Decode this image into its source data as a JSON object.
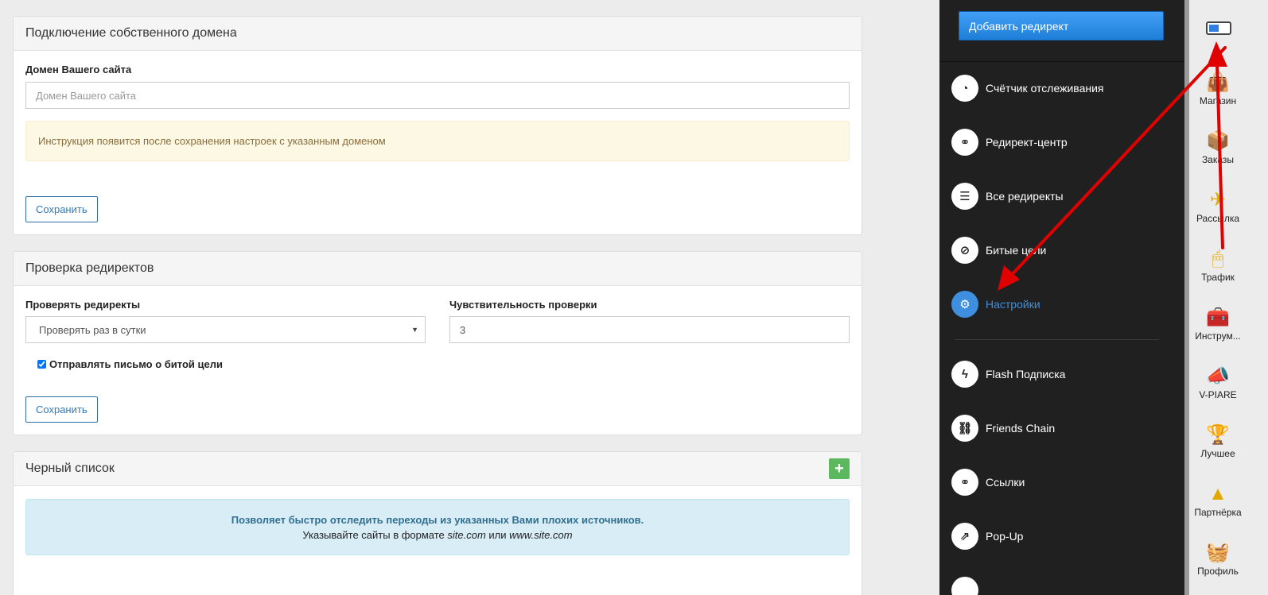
{
  "domain_panel": {
    "title": "Подключение собственного домена",
    "field_label": "Домен Вашего сайта",
    "field_placeholder": "Домен Вашего сайта",
    "notice": "Инструкция появится после сохранения настроек с указанным доменом",
    "save_label": "Сохранить"
  },
  "redirect_check_panel": {
    "title": "Проверка редиректов",
    "check_label": "Проверять редиректы",
    "check_value": "Проверять раз в сутки",
    "sensitivity_label": "Чувствительность проверки",
    "sensitivity_value": "3",
    "email_checkbox_label": "Отправлять письмо о битой цели",
    "email_checked": true,
    "save_label": "Сохранить"
  },
  "blacklist_panel": {
    "title": "Черный список",
    "add_label": "+",
    "info_line1": "Позволяет быстро отследить переходы из указанных Вами плохих источников.",
    "info_line2_prefix": "Указывайте сайты в формате ",
    "info_example1": "site.com",
    "info_or": " или ",
    "info_example2": "www.site.com"
  },
  "sidebar": {
    "add_button": "Добавить редирект",
    "items": [
      {
        "label": "Счётчик отслеживания",
        "icon": "speedometer-icon",
        "glyph": "◔"
      },
      {
        "label": "Редирект-центр",
        "icon": "link-icon",
        "glyph": "⚭"
      },
      {
        "label": "Все редиректы",
        "icon": "list-icon",
        "glyph": "☰"
      },
      {
        "label": "Битые цели",
        "icon": "ban-icon",
        "glyph": "⊘"
      },
      {
        "label": "Настройки",
        "icon": "gear-icon",
        "glyph": "⚙",
        "active": true
      },
      {
        "label": "Flash Подписка",
        "icon": "bolt-icon",
        "glyph": "ϟ"
      },
      {
        "label": "Friends Chain",
        "icon": "chain-broken-icon",
        "glyph": "⛓"
      },
      {
        "label": "Ссылки",
        "icon": "link-icon",
        "glyph": "⚭"
      },
      {
        "label": "Pop-Up",
        "icon": "external-link-icon",
        "glyph": "⇗"
      }
    ]
  },
  "rail": {
    "items": [
      {
        "label": "Магазин",
        "icon": "shop-bag-icon",
        "glyph": "👜"
      },
      {
        "label": "Заказы",
        "icon": "orders-box-icon",
        "glyph": "📦"
      },
      {
        "label": "Рассылка",
        "icon": "paper-plane-icon",
        "glyph": "✈"
      },
      {
        "label": "Трафик",
        "icon": "mouse-icon",
        "glyph": "🖱"
      },
      {
        "label": "Инструм...",
        "icon": "toolbox-icon",
        "glyph": "🧰"
      },
      {
        "label": "V-PIARE",
        "icon": "megaphone-icon",
        "glyph": "📣"
      },
      {
        "label": "Лучшее",
        "icon": "trophy-icon",
        "glyph": "🏆"
      },
      {
        "label": "Партнёрка",
        "icon": "pyramid-icon",
        "glyph": "▲"
      },
      {
        "label": "Профиль",
        "icon": "basket-icon",
        "glyph": "🧺"
      }
    ]
  },
  "colors": {
    "accent": "#3e8fdf",
    "sidebar_bg": "#202020",
    "annotation_arrow": "#e00000"
  }
}
